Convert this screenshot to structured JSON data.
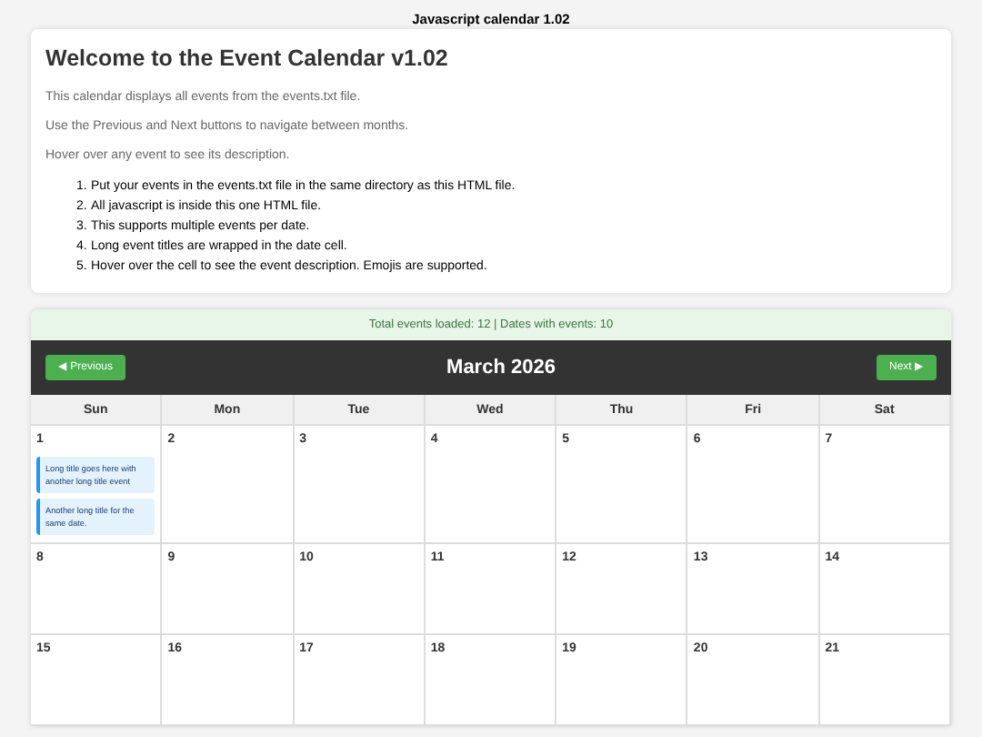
{
  "page_title": "Javascript calendar 1.02",
  "intro": {
    "heading": "Welcome to the Event Calendar v1.02",
    "paragraphs": [
      "This calendar displays all events from the events.txt file.",
      "Use the Previous and Next buttons to navigate between months.",
      "Hover over any event to see its description."
    ],
    "steps": [
      {
        "number": "1.",
        "text": "Put your events in the events.txt file in the same directory as this HTML file."
      },
      {
        "number": "2.",
        "text": "All javascript is inside this one HTML file."
      },
      {
        "number": "3.",
        "text": "This supports multiple events per date."
      },
      {
        "number": "4.",
        "text": "Long event titles are wrapped in the date cell."
      },
      {
        "number": "5.",
        "text": "Hover over the cell to see the event description. Emojis are supported."
      }
    ]
  },
  "status": "Total events loaded: 12 | Dates with events: 10",
  "calendar": {
    "month": "March 2026",
    "prev_button": "◀ Previous",
    "next_button": "Next ▶",
    "weekdays": [
      "Sun",
      "Mon",
      "Tue",
      "Wed",
      "Thu",
      "Fri",
      "Sat"
    ],
    "weeks": [
      [
        {
          "day": "1",
          "events": [
            "Long title goes here with another long title event",
            "Another long title for the same date."
          ]
        },
        {
          "day": "2"
        },
        {
          "day": "3"
        },
        {
          "day": "4"
        },
        {
          "day": "5"
        },
        {
          "day": "6"
        },
        {
          "day": "7"
        }
      ],
      [
        {
          "day": "8"
        },
        {
          "day": "9"
        },
        {
          "day": "10"
        },
        {
          "day": "11"
        },
        {
          "day": "12"
        },
        {
          "day": "13"
        },
        {
          "day": "14"
        }
      ],
      [
        {
          "day": "15"
        },
        {
          "day": "16"
        },
        {
          "day": "17"
        },
        {
          "day": "18"
        },
        {
          "day": "19"
        },
        {
          "day": "20"
        },
        {
          "day": "21"
        }
      ]
    ]
  }
}
